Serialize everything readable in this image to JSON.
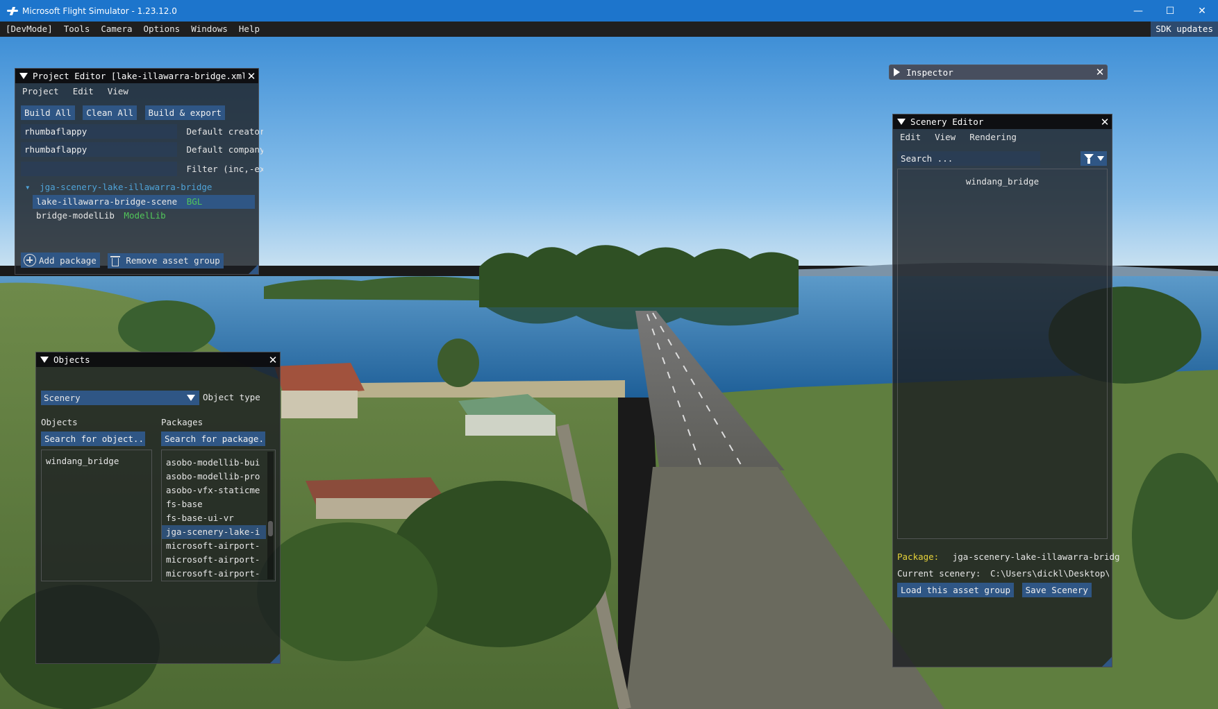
{
  "window": {
    "title": "Microsoft Flight Simulator - 1.23.12.0",
    "minimize": "—",
    "maximize": "☐",
    "close": "✕"
  },
  "devbar": {
    "items": [
      "[DevMode]",
      "Tools",
      "Camera",
      "Options",
      "Windows",
      "Help"
    ],
    "sdk_updates": "SDK updates"
  },
  "project_editor": {
    "title": "Project Editor [lake-illawarra-bridge.xml]",
    "menu": [
      "Project",
      "Edit",
      "View"
    ],
    "buttons": [
      "Build All",
      "Clean All",
      "Build & export"
    ],
    "creator_value": "rhumbaflappy",
    "creator_label": "Default creator",
    "company_value": "rhumbaflappy",
    "company_label": "Default company",
    "filter_value": "",
    "filter_label": "Filter (inc,-ex",
    "tree_root": "jga-scenery-lake-illawarra-bridge",
    "items": [
      {
        "name": "lake-illawarra-bridge-scene",
        "tag": "BGL"
      },
      {
        "name": "bridge-modelLib",
        "tag": "ModelLib"
      }
    ],
    "add_package": "Add package",
    "remove_asset_group": "Remove asset group"
  },
  "inspector": {
    "title": "Inspector"
  },
  "scenery_editor": {
    "title": "Scenery Editor",
    "menu": [
      "Edit",
      "View",
      "Rendering"
    ],
    "search_placeholder": "Search ...",
    "list": [
      "windang_bridge"
    ],
    "package_label": "Package:",
    "package_value": "jga-scenery-lake-illawarra-bridg",
    "current_scenery_label": "Current scenery:",
    "current_scenery_value": "C:\\Users\\dickl\\Desktop\\la",
    "load_button": "Load this asset group",
    "save_button": "Save Scenery"
  },
  "objects_panel": {
    "title": "Objects",
    "type_value": "Scenery",
    "type_label": "Object type",
    "objects_header": "Objects",
    "packages_header": "Packages",
    "objects_search": "Search for object...",
    "packages_search": "Search for package...",
    "objects": [
      "windang_bridge"
    ],
    "packages": [
      "asobo-modellib-bui",
      "asobo-modellib-pro",
      "asobo-vfx-staticme",
      "fs-base",
      "fs-base-ui-vr",
      "jga-scenery-lake-i",
      "microsoft-airport-",
      "microsoft-airport-",
      "microsoft-airport-"
    ],
    "selected_package_index": 5
  }
}
